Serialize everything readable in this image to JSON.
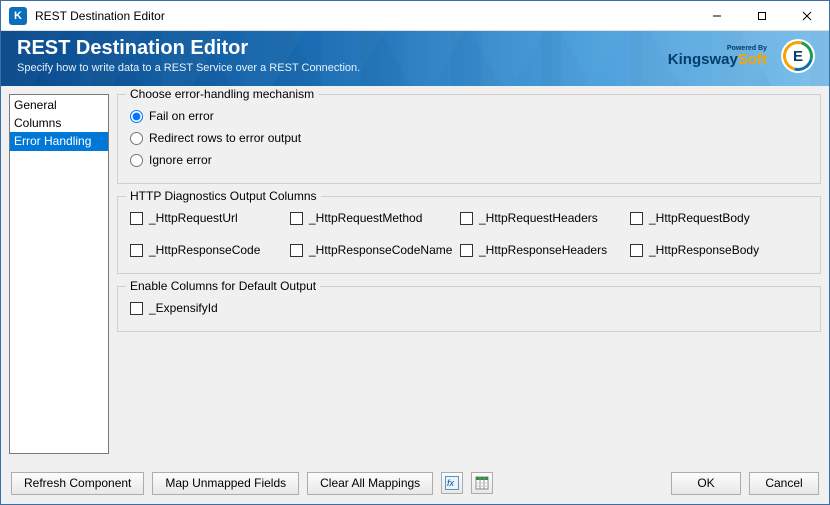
{
  "window": {
    "title": "REST Destination Editor"
  },
  "banner": {
    "title": "REST Destination Editor",
    "subtitle": "Specify how to write data to a REST Service over a REST Connection.",
    "powered_by": "Powered By",
    "logo_text_a": "Kingsway",
    "logo_text_b": "Soft",
    "logo_e": "E"
  },
  "sidebar": {
    "items": [
      {
        "label": "General",
        "selected": false
      },
      {
        "label": "Columns",
        "selected": false
      },
      {
        "label": "Error Handling",
        "selected": true
      }
    ]
  },
  "error_group": {
    "legend": "Choose error-handling mechanism",
    "options": [
      {
        "label": "Fail on error",
        "checked": true
      },
      {
        "label": "Redirect rows to error output",
        "checked": false
      },
      {
        "label": "Ignore error",
        "checked": false
      }
    ]
  },
  "diag_group": {
    "legend": "HTTP Diagnostics Output Columns",
    "columns": [
      "_HttpRequestUrl",
      "_HttpRequestMethod",
      "_HttpRequestHeaders",
      "_HttpRequestBody",
      "_HttpResponseCode",
      "_HttpResponseCodeName",
      "_HttpResponseHeaders",
      "_HttpResponseBody"
    ]
  },
  "default_output_group": {
    "legend": "Enable Columns for Default Output",
    "columns": [
      "_ExpensifyId"
    ]
  },
  "footer": {
    "refresh": "Refresh Component",
    "map_unmapped": "Map Unmapped Fields",
    "clear_mappings": "Clear All Mappings",
    "ok": "OK",
    "cancel": "Cancel"
  }
}
